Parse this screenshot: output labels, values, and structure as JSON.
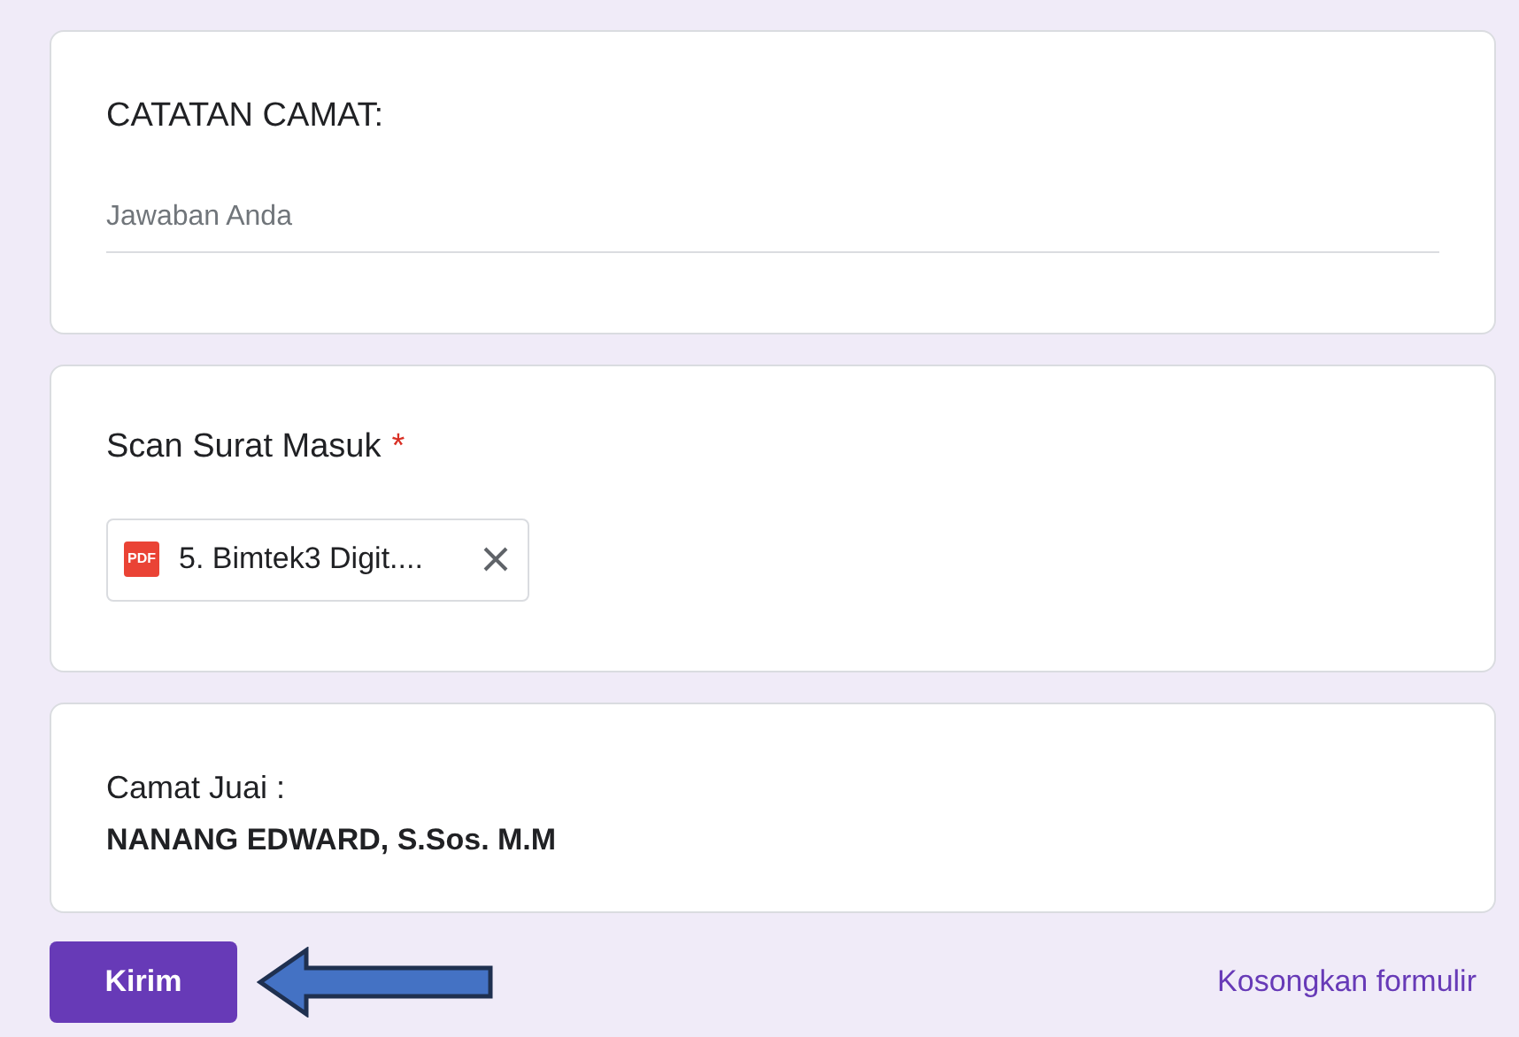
{
  "questions": [
    {
      "kind": "text",
      "title": "CATATAN CAMAT:",
      "placeholder": "Jawaban Anda"
    },
    {
      "kind": "file",
      "title": "Scan Surat Masuk",
      "required_mark": "*",
      "file": {
        "badge": "PDF",
        "name": "5. Bimtek3 Digit...."
      }
    },
    {
      "kind": "info",
      "title": "Camat Juai :",
      "text": "NANANG EDWARD, S.Sos. M.M"
    }
  ],
  "submit": "Kirim",
  "clear": "Kosongkan formulir"
}
